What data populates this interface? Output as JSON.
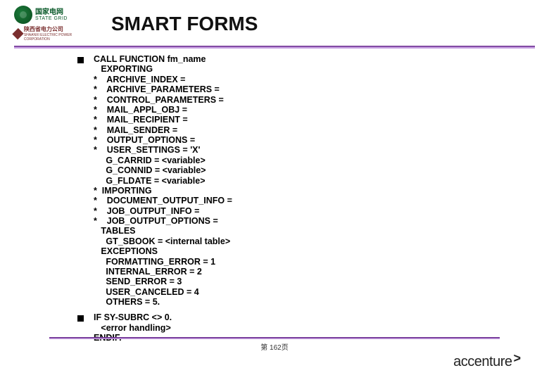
{
  "header": {
    "logo1_cn": "国家电网",
    "logo1_en": "STATE GRID",
    "logo2_cn": "陕西省电力公司",
    "logo2_en": "SHAANXI ELECTRIC POWER CORPORATION",
    "title": "SMART FORMS"
  },
  "code_block_1": "CALL FUNCTION fm_name\n   EXPORTING\n*    ARCHIVE_INDEX =\n*    ARCHIVE_PARAMETERS =\n*    CONTROL_PARAMETERS =\n*    MAIL_APPL_OBJ =\n*    MAIL_RECIPIENT =\n*    MAIL_SENDER =\n*    OUTPUT_OPTIONS =\n*    USER_SETTINGS = 'X'\n     G_CARRID = <variable>\n     G_CONNID = <variable>\n     G_FLDATE = <variable>\n*  IMPORTING\n*    DOCUMENT_OUTPUT_INFO =\n*    JOB_OUTPUT_INFO =\n*    JOB_OUTPUT_OPTIONS =\n   TABLES\n     GT_SBOOK = <internal table>\n   EXCEPTIONS\n     FORMATTING_ERROR = 1\n     INTERNAL_ERROR = 2\n     SEND_ERROR = 3\n     USER_CANCELED = 4\n     OTHERS = 5.",
  "code_block_2": "IF SY-SUBRC <> 0.\n   <error handling>\nENDIF.",
  "footer": {
    "page": "第 162页",
    "brand": "accenture",
    "arrow": ">"
  }
}
